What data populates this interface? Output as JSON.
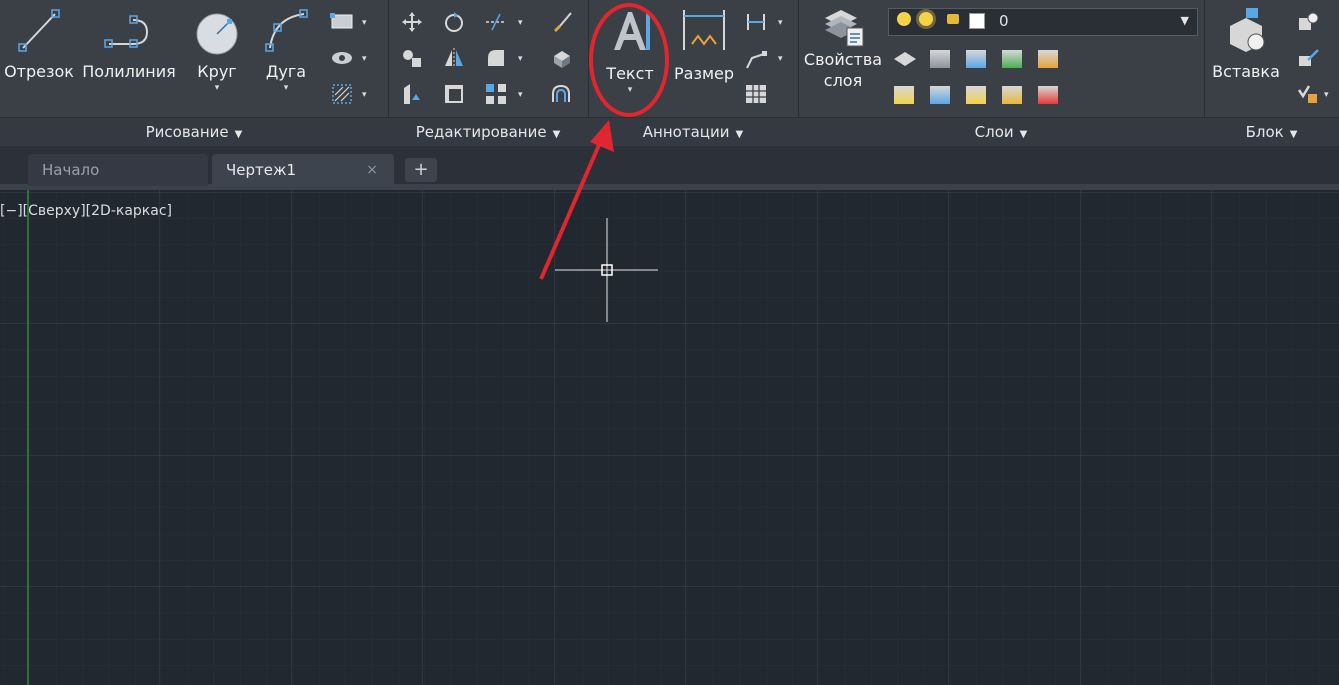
{
  "ribbon": {
    "panels": {
      "draw": {
        "title": "Рисование",
        "line": "Отрезок",
        "polyline": "Полилиния",
        "circle": "Круг",
        "arc": "Дуга"
      },
      "modify": {
        "title": "Редактирование"
      },
      "annotation": {
        "title": "Аннотации",
        "text": "Текст",
        "dimension": "Размер"
      },
      "layers": {
        "title": "Слои",
        "layer_properties_line1": "Свойства",
        "layer_properties_line2": "слоя",
        "current_layer": "0"
      },
      "block": {
        "title": "Блок",
        "insert": "Вставка"
      }
    }
  },
  "tabs": {
    "start": "Начало",
    "drawing": "Чертеж1",
    "close": "×",
    "add": "+"
  },
  "viewport": {
    "label": "[−][Сверху][2D-каркас]"
  },
  "colors": {
    "ribbon_bg": "#3b3f46",
    "canvas_bg": "#212830",
    "grid_major": "#3a4452",
    "grid_minor": "#283039",
    "highlight_red": "#e0262e",
    "y_axis": "#2f8a3a"
  }
}
